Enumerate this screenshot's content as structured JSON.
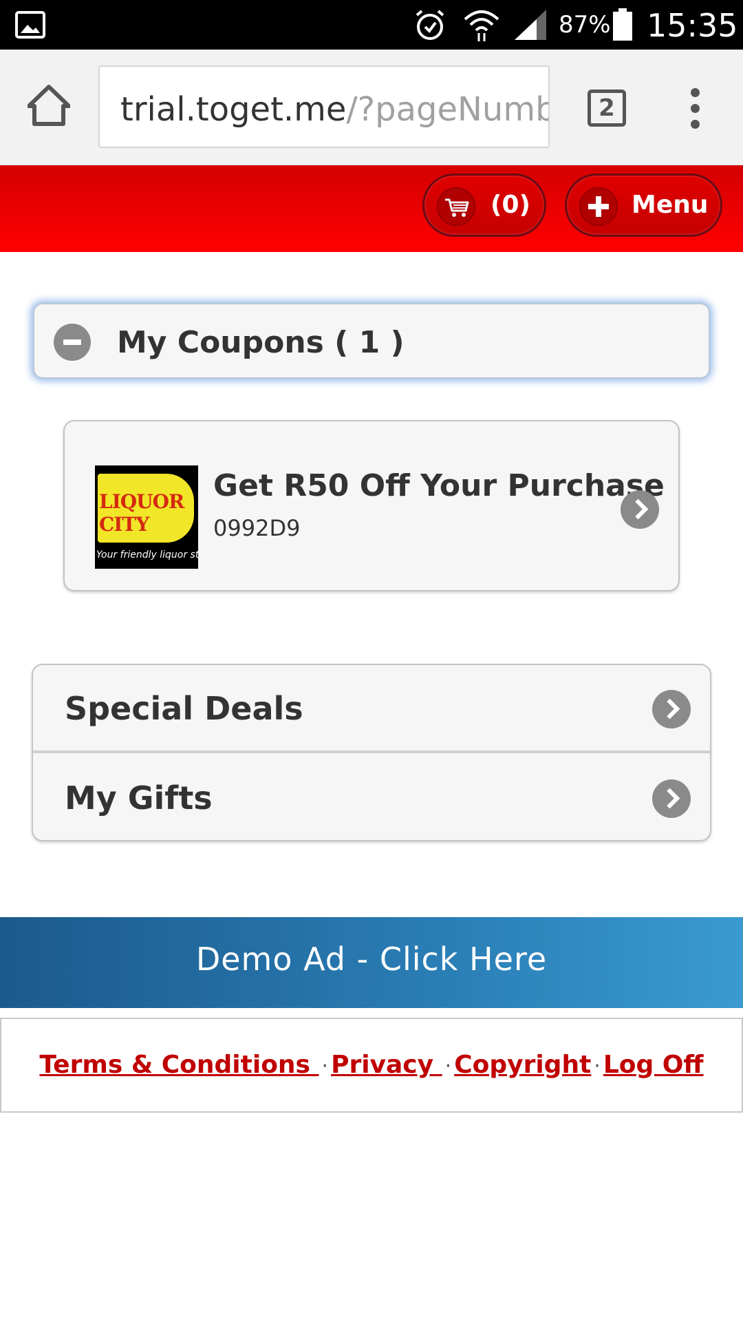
{
  "status_bar": {
    "battery_percent": "87%",
    "time": "15:35",
    "icons": [
      "gallery-icon",
      "alarm-icon",
      "wifi-icon",
      "signal-icon",
      "battery-icon"
    ]
  },
  "browser": {
    "url_host": "trial.toget.me",
    "url_path": "/?pageNumb",
    "tab_count": "2"
  },
  "header": {
    "cart_label": "(0)",
    "menu_label": "Menu",
    "colors": {
      "header_red": "#ff0000",
      "pill_border": "#6b0b15"
    }
  },
  "coupons": {
    "heading": "My Coupons ( 1 )",
    "items": [
      {
        "title": "Get R50 Off Your Purchase",
        "code": "0992D9",
        "logo_text": "LIQUOR CITY",
        "logo_slogan": "Your friendly liquor store"
      }
    ]
  },
  "nav": {
    "items": [
      {
        "label": "Special Deals"
      },
      {
        "label": "My Gifts"
      }
    ]
  },
  "ad": {
    "label": "Demo Ad - Click Here"
  },
  "footer": {
    "links": [
      "Terms & Conditions ",
      "Privacy ",
      "Copyright",
      "Log Off"
    ],
    "separator": "·",
    "link_color": "#c00000"
  }
}
